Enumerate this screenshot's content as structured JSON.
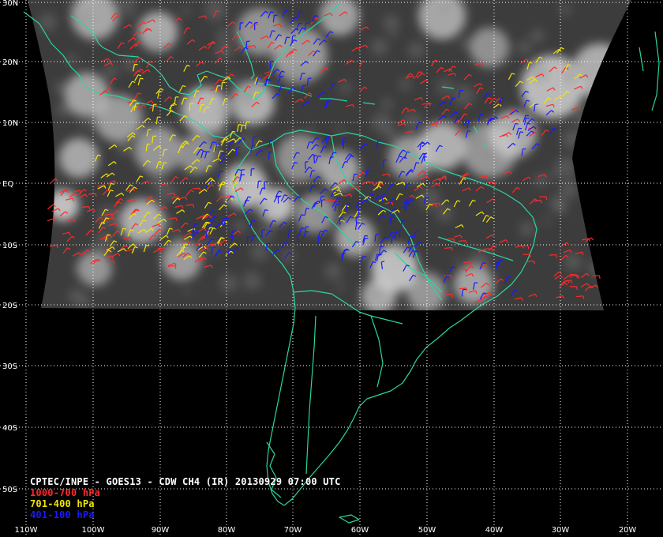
{
  "title": "CPTEC/INPE - GOES13 - CDW CH4 (IR) 20130929 07:00 UTC",
  "legend": [
    {
      "label": "1000-700 hPa",
      "color": "#ff2a2a"
    },
    {
      "label": "701-400 hPa",
      "color": "#f2e600"
    },
    {
      "label": "401-100 hPa",
      "color": "#1a1aff"
    }
  ],
  "latitude_labels": [
    "30N",
    "20N",
    "10N",
    "EQ",
    "10S",
    "20S",
    "30S",
    "40S",
    "50S"
  ],
  "longitude_labels": [
    "110W",
    "100W",
    "90W",
    "80W",
    "70W",
    "60W",
    "50W",
    "40W",
    "30W",
    "20W"
  ],
  "colors": {
    "background": "#000000",
    "coastline": "#2ad6a0",
    "grid": "#ffffff",
    "satellite_dark": "#3a3a3a",
    "satellite_cloud": "#d8d8d8"
  },
  "icons": [
    "wind-barb-icon"
  ]
}
